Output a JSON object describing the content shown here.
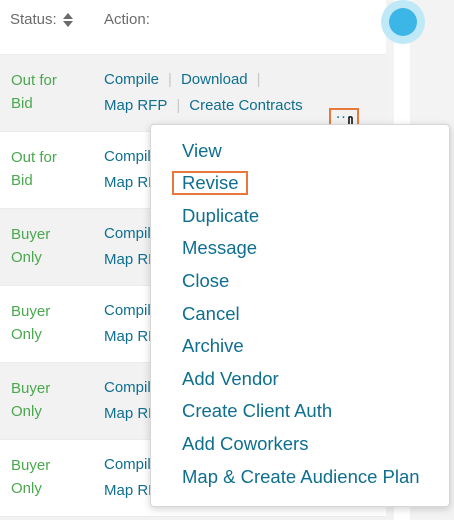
{
  "header": {
    "status_label": "Status:",
    "action_label": "Action:"
  },
  "rows": [
    {
      "status_line1": "Out for",
      "status_line2": "Bid",
      "action_compile": "Compile",
      "action_download": "Download",
      "action_map_rfp": "Map RFP",
      "action_create_contracts": "Create Contracts",
      "more": "..."
    },
    {
      "status_line1": "Out for",
      "status_line2": "Bid",
      "action_compile": "Compile",
      "action_map_rfp": "Map RFP"
    },
    {
      "status_line1": "Buyer",
      "status_line2": "Only",
      "action_compile": "Compile",
      "action_map_rfp": "Map RFP"
    },
    {
      "status_line1": "Buyer",
      "status_line2": "Only",
      "action_compile": "Compile",
      "action_map_rfp": "Map RFP"
    },
    {
      "status_line1": "Buyer",
      "status_line2": "Only",
      "action_compile": "Compile",
      "action_map_rfp": "Map RFP"
    },
    {
      "status_line1": "Buyer",
      "status_line2": "Only",
      "action_compile": "Compile",
      "action_map_rfp": "Map RFP"
    }
  ],
  "separator": "|",
  "dropdown": {
    "items": [
      "View",
      "Revise",
      "Duplicate",
      "Message",
      "Close",
      "Cancel",
      "Archive",
      "Add Vendor",
      "Create Client Auth",
      "Add Coworkers",
      "Map & Create Audience Plan"
    ],
    "highlighted_item": "Revise"
  },
  "icons": {
    "sort": "sort-icon",
    "pointer": "hand-pointer-icon",
    "scroll": "scroll-thumb"
  },
  "colors": {
    "link": "#0f6f8f",
    "status_green": "#4aa84d",
    "highlight_orange": "#e8793a",
    "scroll_blue": "#3cb6e6",
    "row_alt_bg": "#f2f2f2"
  }
}
